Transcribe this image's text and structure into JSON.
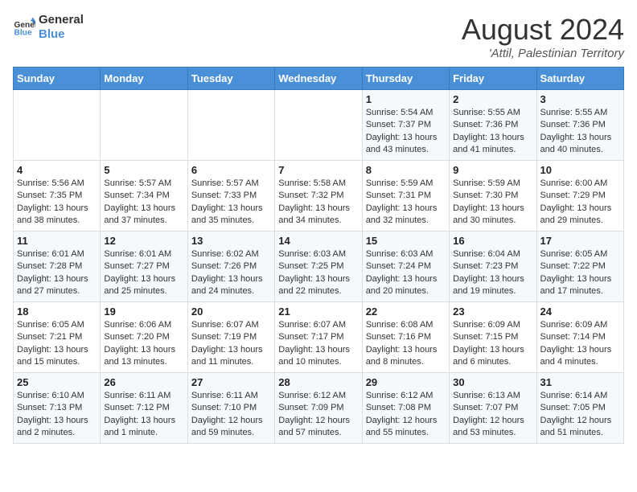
{
  "header": {
    "logo_line1": "General",
    "logo_line2": "Blue",
    "month_year": "August 2024",
    "location": "'Attil, Palestinian Territory"
  },
  "weekdays": [
    "Sunday",
    "Monday",
    "Tuesday",
    "Wednesday",
    "Thursday",
    "Friday",
    "Saturday"
  ],
  "weeks": [
    [
      {
        "day": "",
        "info": ""
      },
      {
        "day": "",
        "info": ""
      },
      {
        "day": "",
        "info": ""
      },
      {
        "day": "",
        "info": ""
      },
      {
        "day": "1",
        "info": "Sunrise: 5:54 AM\nSunset: 7:37 PM\nDaylight: 13 hours\nand 43 minutes."
      },
      {
        "day": "2",
        "info": "Sunrise: 5:55 AM\nSunset: 7:36 PM\nDaylight: 13 hours\nand 41 minutes."
      },
      {
        "day": "3",
        "info": "Sunrise: 5:55 AM\nSunset: 7:36 PM\nDaylight: 13 hours\nand 40 minutes."
      }
    ],
    [
      {
        "day": "4",
        "info": "Sunrise: 5:56 AM\nSunset: 7:35 PM\nDaylight: 13 hours\nand 38 minutes."
      },
      {
        "day": "5",
        "info": "Sunrise: 5:57 AM\nSunset: 7:34 PM\nDaylight: 13 hours\nand 37 minutes."
      },
      {
        "day": "6",
        "info": "Sunrise: 5:57 AM\nSunset: 7:33 PM\nDaylight: 13 hours\nand 35 minutes."
      },
      {
        "day": "7",
        "info": "Sunrise: 5:58 AM\nSunset: 7:32 PM\nDaylight: 13 hours\nand 34 minutes."
      },
      {
        "day": "8",
        "info": "Sunrise: 5:59 AM\nSunset: 7:31 PM\nDaylight: 13 hours\nand 32 minutes."
      },
      {
        "day": "9",
        "info": "Sunrise: 5:59 AM\nSunset: 7:30 PM\nDaylight: 13 hours\nand 30 minutes."
      },
      {
        "day": "10",
        "info": "Sunrise: 6:00 AM\nSunset: 7:29 PM\nDaylight: 13 hours\nand 29 minutes."
      }
    ],
    [
      {
        "day": "11",
        "info": "Sunrise: 6:01 AM\nSunset: 7:28 PM\nDaylight: 13 hours\nand 27 minutes."
      },
      {
        "day": "12",
        "info": "Sunrise: 6:01 AM\nSunset: 7:27 PM\nDaylight: 13 hours\nand 25 minutes."
      },
      {
        "day": "13",
        "info": "Sunrise: 6:02 AM\nSunset: 7:26 PM\nDaylight: 13 hours\nand 24 minutes."
      },
      {
        "day": "14",
        "info": "Sunrise: 6:03 AM\nSunset: 7:25 PM\nDaylight: 13 hours\nand 22 minutes."
      },
      {
        "day": "15",
        "info": "Sunrise: 6:03 AM\nSunset: 7:24 PM\nDaylight: 13 hours\nand 20 minutes."
      },
      {
        "day": "16",
        "info": "Sunrise: 6:04 AM\nSunset: 7:23 PM\nDaylight: 13 hours\nand 19 minutes."
      },
      {
        "day": "17",
        "info": "Sunrise: 6:05 AM\nSunset: 7:22 PM\nDaylight: 13 hours\nand 17 minutes."
      }
    ],
    [
      {
        "day": "18",
        "info": "Sunrise: 6:05 AM\nSunset: 7:21 PM\nDaylight: 13 hours\nand 15 minutes."
      },
      {
        "day": "19",
        "info": "Sunrise: 6:06 AM\nSunset: 7:20 PM\nDaylight: 13 hours\nand 13 minutes."
      },
      {
        "day": "20",
        "info": "Sunrise: 6:07 AM\nSunset: 7:19 PM\nDaylight: 13 hours\nand 11 minutes."
      },
      {
        "day": "21",
        "info": "Sunrise: 6:07 AM\nSunset: 7:17 PM\nDaylight: 13 hours\nand 10 minutes."
      },
      {
        "day": "22",
        "info": "Sunrise: 6:08 AM\nSunset: 7:16 PM\nDaylight: 13 hours\nand 8 minutes."
      },
      {
        "day": "23",
        "info": "Sunrise: 6:09 AM\nSunset: 7:15 PM\nDaylight: 13 hours\nand 6 minutes."
      },
      {
        "day": "24",
        "info": "Sunrise: 6:09 AM\nSunset: 7:14 PM\nDaylight: 13 hours\nand 4 minutes."
      }
    ],
    [
      {
        "day": "25",
        "info": "Sunrise: 6:10 AM\nSunset: 7:13 PM\nDaylight: 13 hours\nand 2 minutes."
      },
      {
        "day": "26",
        "info": "Sunrise: 6:11 AM\nSunset: 7:12 PM\nDaylight: 13 hours\nand 1 minute."
      },
      {
        "day": "27",
        "info": "Sunrise: 6:11 AM\nSunset: 7:10 PM\nDaylight: 12 hours\nand 59 minutes."
      },
      {
        "day": "28",
        "info": "Sunrise: 6:12 AM\nSunset: 7:09 PM\nDaylight: 12 hours\nand 57 minutes."
      },
      {
        "day": "29",
        "info": "Sunrise: 6:12 AM\nSunset: 7:08 PM\nDaylight: 12 hours\nand 55 minutes."
      },
      {
        "day": "30",
        "info": "Sunrise: 6:13 AM\nSunset: 7:07 PM\nDaylight: 12 hours\nand 53 minutes."
      },
      {
        "day": "31",
        "info": "Sunrise: 6:14 AM\nSunset: 7:05 PM\nDaylight: 12 hours\nand 51 minutes."
      }
    ]
  ]
}
